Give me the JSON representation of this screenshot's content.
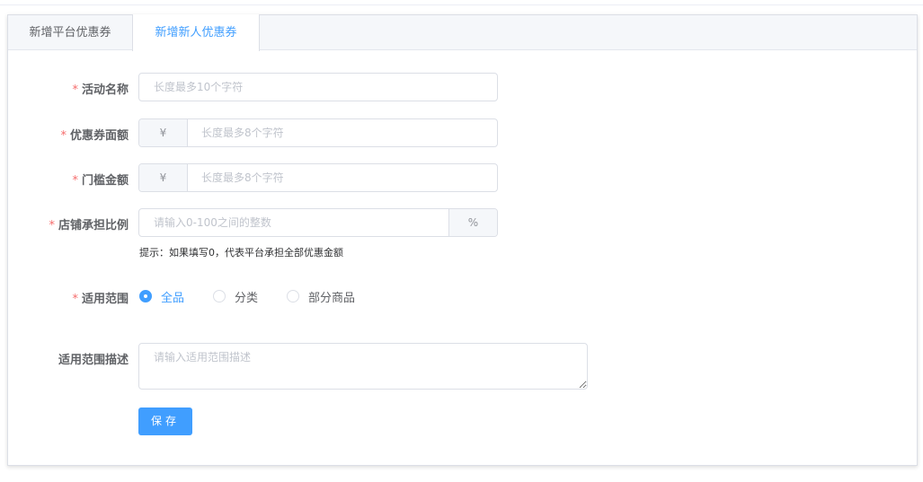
{
  "tabs": [
    {
      "label": "新增平台优惠券",
      "active": false
    },
    {
      "label": "新增新人优惠券",
      "active": true
    }
  ],
  "form": {
    "required_mark": "*",
    "activity_name": {
      "label": "活动名称",
      "placeholder": "长度最多10个字符"
    },
    "coupon_amount": {
      "label": "优惠券面额",
      "prefix": "¥",
      "placeholder": "长度最多8个字符"
    },
    "threshold_amount": {
      "label": "门槛金额",
      "prefix": "¥",
      "placeholder": "长度最多8个字符"
    },
    "store_ratio": {
      "label": "店铺承担比例",
      "placeholder": "请输入0-100之间的整数",
      "suffix": "%",
      "hint": "提示：如果填写0，代表平台承担全部优惠金额"
    },
    "scope": {
      "label": "适用范围",
      "options": [
        {
          "label": "全品",
          "checked": true
        },
        {
          "label": "分类",
          "checked": false
        },
        {
          "label": "部分商品",
          "checked": false
        }
      ]
    },
    "scope_desc": {
      "label": "适用范围描述",
      "placeholder": "请输入适用范围描述"
    },
    "save_label": "保存"
  },
  "colors": {
    "accent": "#409eff",
    "required": "#f56c6c"
  }
}
